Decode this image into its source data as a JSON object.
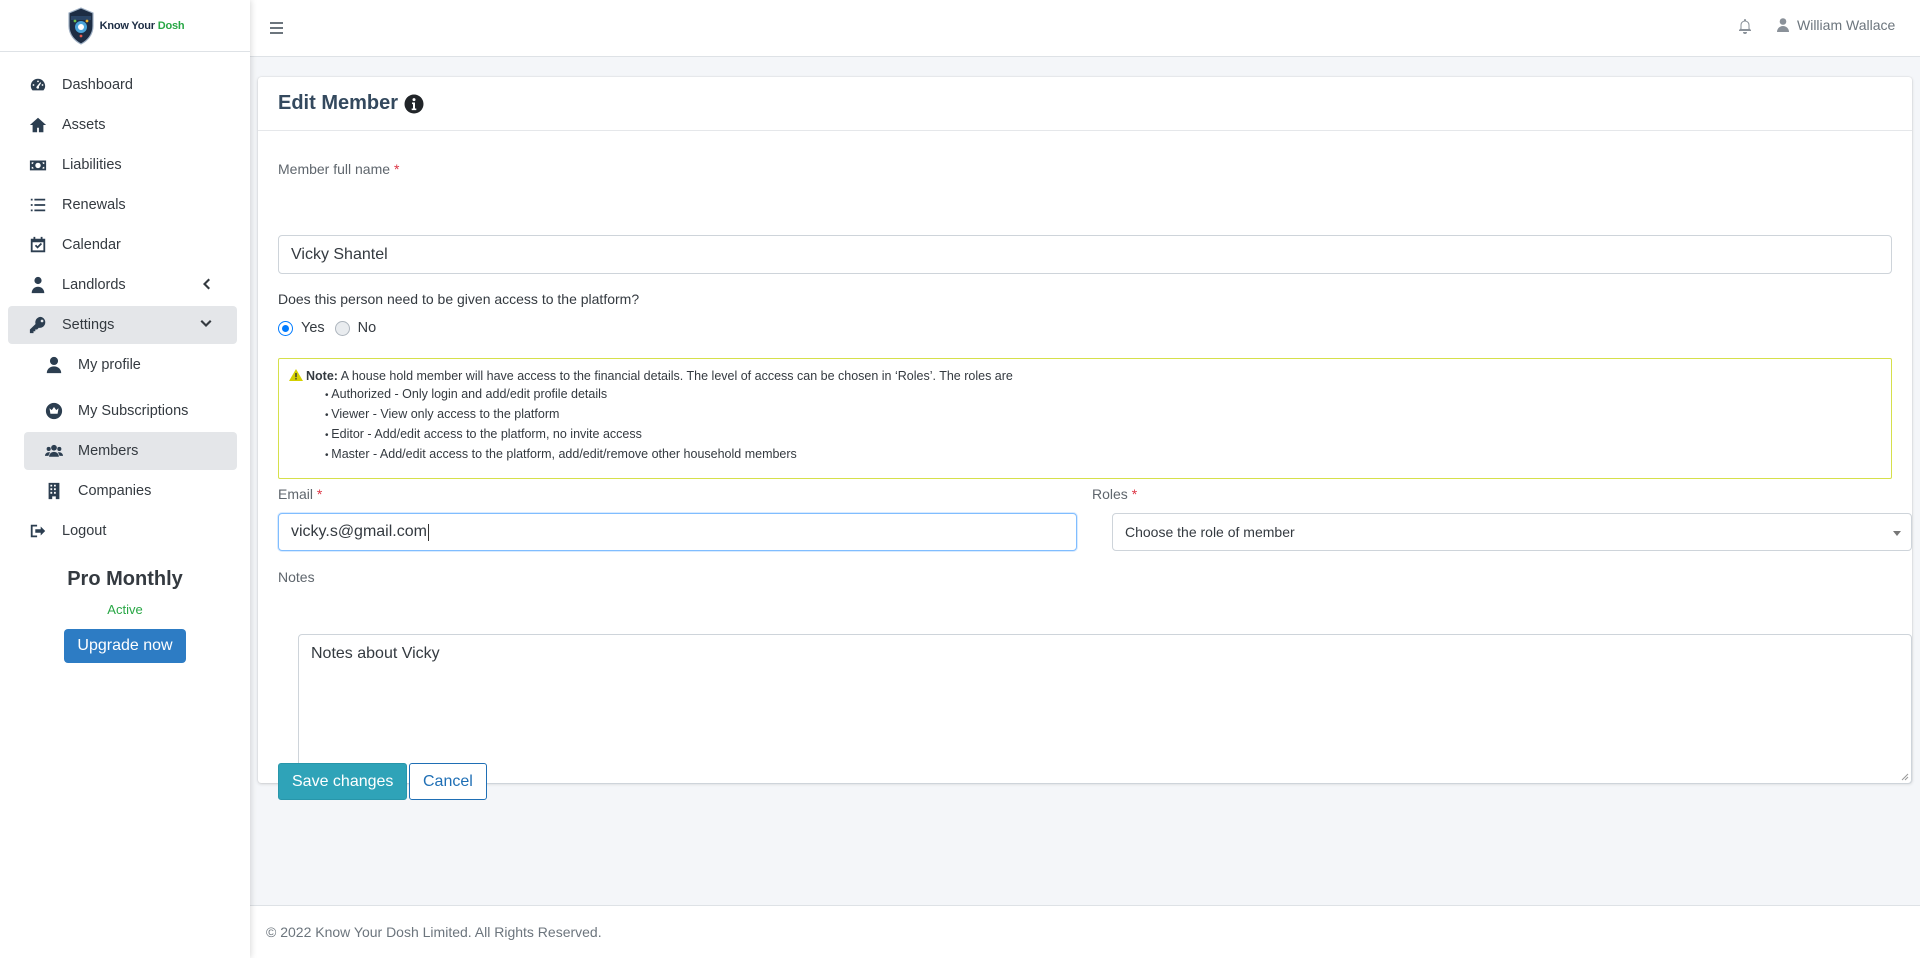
{
  "brand": {
    "name_part1": "Know Your",
    "name_part2": "Dosh"
  },
  "sidebar": {
    "items": [
      {
        "label": "Dashboard",
        "icon": "tachometer-icon"
      },
      {
        "label": "Assets",
        "icon": "home-icon"
      },
      {
        "label": "Liabilities",
        "icon": "money-bill-icon"
      },
      {
        "label": "Renewals",
        "icon": "list-icon"
      },
      {
        "label": "Calendar",
        "icon": "calendar-check-icon"
      },
      {
        "label": "Landlords",
        "icon": "user-tie-icon"
      },
      {
        "label": "Settings",
        "icon": "key-icon"
      }
    ],
    "settings_sub": [
      {
        "label": "My profile",
        "icon": "user-icon"
      },
      {
        "label": "My Subscriptions",
        "icon": "crown-icon"
      },
      {
        "label": "Members",
        "icon": "users-icon"
      },
      {
        "label": "Companies",
        "icon": "building-icon"
      }
    ],
    "logout_label": "Logout",
    "plan": {
      "name": "Pro Monthly",
      "status": "Active",
      "upgrade_label": "Upgrade now"
    }
  },
  "topbar": {
    "user_name": "William Wallace"
  },
  "form": {
    "title": "Edit Member",
    "full_name_label": "Member full name",
    "required_mark": "*",
    "full_name_value": "Vicky Shantel",
    "access_question": "Does this person need to be given access to the platform?",
    "access_yes": "Yes",
    "access_no": "No",
    "access_selected": "Yes",
    "note": {
      "prefix": "Note:",
      "text": " A house hold member will have access to the financial details. The level of access can be chosen in ‘Roles’. The roles are",
      "roles": [
        "Authorized - Only login and add/edit profile details",
        "Viewer - View only access to the platform",
        "Editor - Add/edit access to the platform, no invite access",
        "Master - Add/edit access to the platform, add/edit/remove other household members"
      ]
    },
    "email_label": "Email",
    "email_value": "vicky.s@gmail.com",
    "roles_label": "Roles",
    "roles_placeholder": "Choose the role of member",
    "notes_label": "Notes",
    "notes_value": "Notes about Vicky",
    "save_label": "Save changes",
    "cancel_label": "Cancel"
  },
  "footer": {
    "text": "© 2022 Know Your Dosh Limited. All Rights Reserved."
  }
}
